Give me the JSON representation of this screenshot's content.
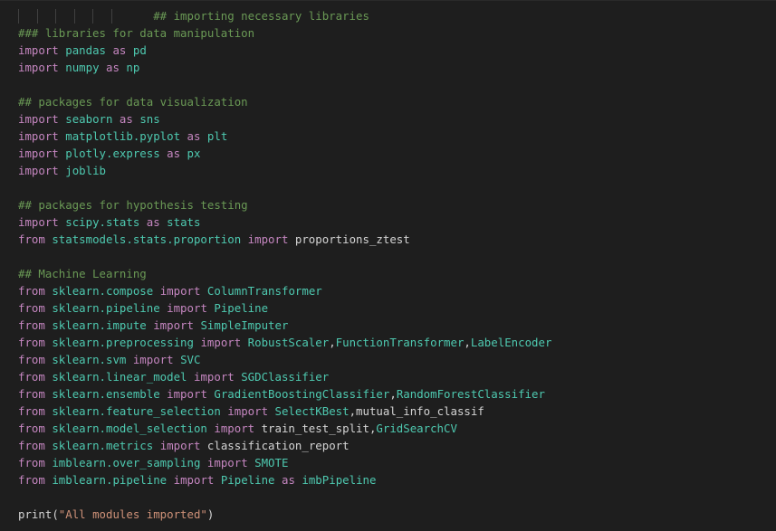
{
  "colors": {
    "background": "#1e1e1e",
    "comment": "#6a9955",
    "keyword": "#c586c0",
    "module": "#4ec9b0",
    "class": "#4ec9b0",
    "function": "#dcdcaa",
    "string": "#ce9178",
    "text": "#d4d4d4",
    "indent_guide": "#404040"
  },
  "indent_guides": 6,
  "lines": [
    {
      "indent": 6,
      "tokens": [
        {
          "t": "## importing necessary libraries",
          "c": "comment"
        }
      ]
    },
    {
      "tokens": [
        {
          "t": "### libraries for data manipulation",
          "c": "comment"
        }
      ]
    },
    {
      "tokens": [
        {
          "t": "import",
          "c": "keyword"
        },
        {
          "t": " "
        },
        {
          "t": "pandas",
          "c": "module"
        },
        {
          "t": " "
        },
        {
          "t": "as",
          "c": "keyword"
        },
        {
          "t": " "
        },
        {
          "t": "pd",
          "c": "alias"
        }
      ]
    },
    {
      "tokens": [
        {
          "t": "import",
          "c": "keyword"
        },
        {
          "t": " "
        },
        {
          "t": "numpy",
          "c": "module"
        },
        {
          "t": " "
        },
        {
          "t": "as",
          "c": "keyword"
        },
        {
          "t": " "
        },
        {
          "t": "np",
          "c": "alias"
        }
      ]
    },
    {
      "tokens": []
    },
    {
      "tokens": [
        {
          "t": "## packages for data visualization",
          "c": "comment"
        }
      ]
    },
    {
      "tokens": [
        {
          "t": "import",
          "c": "keyword"
        },
        {
          "t": " "
        },
        {
          "t": "seaborn",
          "c": "module"
        },
        {
          "t": " "
        },
        {
          "t": "as",
          "c": "keyword"
        },
        {
          "t": " "
        },
        {
          "t": "sns",
          "c": "alias"
        }
      ]
    },
    {
      "tokens": [
        {
          "t": "import",
          "c": "keyword"
        },
        {
          "t": " "
        },
        {
          "t": "matplotlib.pyplot",
          "c": "module"
        },
        {
          "t": " "
        },
        {
          "t": "as",
          "c": "keyword"
        },
        {
          "t": " "
        },
        {
          "t": "plt",
          "c": "alias"
        }
      ]
    },
    {
      "tokens": [
        {
          "t": "import",
          "c": "keyword"
        },
        {
          "t": " "
        },
        {
          "t": "plotly.express",
          "c": "module"
        },
        {
          "t": " "
        },
        {
          "t": "as",
          "c": "keyword"
        },
        {
          "t": " "
        },
        {
          "t": "px",
          "c": "alias"
        }
      ]
    },
    {
      "tokens": [
        {
          "t": "import",
          "c": "keyword"
        },
        {
          "t": " "
        },
        {
          "t": "joblib",
          "c": "module"
        }
      ]
    },
    {
      "tokens": []
    },
    {
      "tokens": [
        {
          "t": "## packages for hypothesis testing",
          "c": "comment"
        }
      ]
    },
    {
      "tokens": [
        {
          "t": "import",
          "c": "keyword"
        },
        {
          "t": " "
        },
        {
          "t": "scipy.stats",
          "c": "module"
        },
        {
          "t": " "
        },
        {
          "t": "as",
          "c": "keyword"
        },
        {
          "t": " "
        },
        {
          "t": "stats",
          "c": "alias"
        }
      ]
    },
    {
      "tokens": [
        {
          "t": "from",
          "c": "keyword"
        },
        {
          "t": " "
        },
        {
          "t": "statsmodels.stats.proportion",
          "c": "module"
        },
        {
          "t": " "
        },
        {
          "t": "import",
          "c": "keyword"
        },
        {
          "t": " "
        },
        {
          "t": "proportions_ztest",
          "c": "function"
        }
      ]
    },
    {
      "tokens": []
    },
    {
      "tokens": [
        {
          "t": "## Machine Learning",
          "c": "comment"
        }
      ]
    },
    {
      "tokens": [
        {
          "t": "from",
          "c": "keyword"
        },
        {
          "t": " "
        },
        {
          "t": "sklearn.compose",
          "c": "module"
        },
        {
          "t": " "
        },
        {
          "t": "import",
          "c": "keyword"
        },
        {
          "t": " "
        },
        {
          "t": "ColumnTransformer",
          "c": "class"
        }
      ]
    },
    {
      "tokens": [
        {
          "t": "from",
          "c": "keyword"
        },
        {
          "t": " "
        },
        {
          "t": "sklearn.pipeline",
          "c": "module"
        },
        {
          "t": " "
        },
        {
          "t": "import",
          "c": "keyword"
        },
        {
          "t": " "
        },
        {
          "t": "Pipeline",
          "c": "class"
        }
      ]
    },
    {
      "tokens": [
        {
          "t": "from",
          "c": "keyword"
        },
        {
          "t": " "
        },
        {
          "t": "sklearn.impute",
          "c": "module"
        },
        {
          "t": " "
        },
        {
          "t": "import",
          "c": "keyword"
        },
        {
          "t": " "
        },
        {
          "t": "SimpleImputer",
          "c": "class"
        }
      ]
    },
    {
      "tokens": [
        {
          "t": "from",
          "c": "keyword"
        },
        {
          "t": " "
        },
        {
          "t": "sklearn.preprocessing",
          "c": "module"
        },
        {
          "t": " "
        },
        {
          "t": "import",
          "c": "keyword"
        },
        {
          "t": " "
        },
        {
          "t": "RobustScaler",
          "c": "class"
        },
        {
          "t": ",",
          "c": "punct"
        },
        {
          "t": "FunctionTransformer",
          "c": "class"
        },
        {
          "t": ",",
          "c": "punct"
        },
        {
          "t": "LabelEncoder",
          "c": "class"
        }
      ]
    },
    {
      "tokens": [
        {
          "t": "from",
          "c": "keyword"
        },
        {
          "t": " "
        },
        {
          "t": "sklearn.svm",
          "c": "module"
        },
        {
          "t": " "
        },
        {
          "t": "import",
          "c": "keyword"
        },
        {
          "t": " "
        },
        {
          "t": "SVC",
          "c": "class"
        }
      ]
    },
    {
      "tokens": [
        {
          "t": "from",
          "c": "keyword"
        },
        {
          "t": " "
        },
        {
          "t": "sklearn.linear_model",
          "c": "module"
        },
        {
          "t": " "
        },
        {
          "t": "import",
          "c": "keyword"
        },
        {
          "t": " "
        },
        {
          "t": "SGDClassifier",
          "c": "class"
        }
      ]
    },
    {
      "tokens": [
        {
          "t": "from",
          "c": "keyword"
        },
        {
          "t": " "
        },
        {
          "t": "sklearn.ensemble",
          "c": "module"
        },
        {
          "t": " "
        },
        {
          "t": "import",
          "c": "keyword"
        },
        {
          "t": " "
        },
        {
          "t": "GradientBoostingClassifier",
          "c": "class"
        },
        {
          "t": ",",
          "c": "punct"
        },
        {
          "t": "RandomForestClassifier",
          "c": "class"
        }
      ]
    },
    {
      "tokens": [
        {
          "t": "from",
          "c": "keyword"
        },
        {
          "t": " "
        },
        {
          "t": "sklearn.feature_selection",
          "c": "module"
        },
        {
          "t": " "
        },
        {
          "t": "import",
          "c": "keyword"
        },
        {
          "t": " "
        },
        {
          "t": "SelectKBest",
          "c": "class"
        },
        {
          "t": ",",
          "c": "punct"
        },
        {
          "t": "mutual_info_classif",
          "c": "function"
        }
      ]
    },
    {
      "tokens": [
        {
          "t": "from",
          "c": "keyword"
        },
        {
          "t": " "
        },
        {
          "t": "sklearn.model_selection",
          "c": "module"
        },
        {
          "t": " "
        },
        {
          "t": "import",
          "c": "keyword"
        },
        {
          "t": " "
        },
        {
          "t": "train_test_split",
          "c": "function"
        },
        {
          "t": ",",
          "c": "punct"
        },
        {
          "t": "GridSearchCV",
          "c": "class"
        }
      ]
    },
    {
      "tokens": [
        {
          "t": "from",
          "c": "keyword"
        },
        {
          "t": " "
        },
        {
          "t": "sklearn.metrics",
          "c": "module"
        },
        {
          "t": " "
        },
        {
          "t": "import",
          "c": "keyword"
        },
        {
          "t": " "
        },
        {
          "t": "classification_report",
          "c": "function"
        }
      ]
    },
    {
      "tokens": [
        {
          "t": "from",
          "c": "keyword"
        },
        {
          "t": " "
        },
        {
          "t": "imblearn.over_sampling",
          "c": "module"
        },
        {
          "t": " "
        },
        {
          "t": "import",
          "c": "keyword"
        },
        {
          "t": " "
        },
        {
          "t": "SMOTE",
          "c": "class"
        }
      ]
    },
    {
      "tokens": [
        {
          "t": "from",
          "c": "keyword"
        },
        {
          "t": " "
        },
        {
          "t": "imblearn.pipeline",
          "c": "module"
        },
        {
          "t": " "
        },
        {
          "t": "import",
          "c": "keyword"
        },
        {
          "t": " "
        },
        {
          "t": "Pipeline",
          "c": "class"
        },
        {
          "t": " "
        },
        {
          "t": "as",
          "c": "keyword"
        },
        {
          "t": " "
        },
        {
          "t": "imbPipeline",
          "c": "class"
        }
      ]
    },
    {
      "tokens": []
    },
    {
      "tokens": [
        {
          "t": "print",
          "c": "function"
        },
        {
          "t": "(",
          "c": "punct"
        },
        {
          "t": "\"All modules imported\"",
          "c": "string"
        },
        {
          "t": ")",
          "c": "punct"
        }
      ]
    }
  ]
}
